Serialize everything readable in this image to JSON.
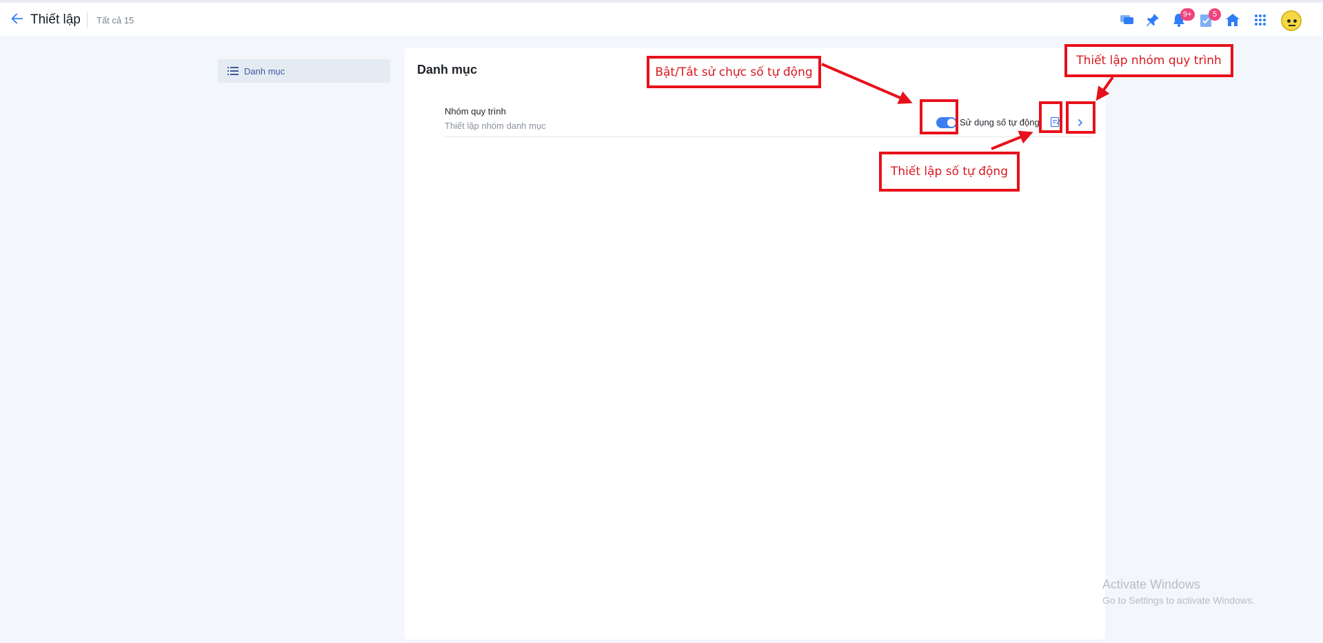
{
  "header": {
    "title": "Thiết lập",
    "count_label": "Tất cả 15",
    "notification_badge": "9+",
    "task_badge": "5"
  },
  "sidebar": {
    "items": [
      {
        "label": "Danh mục",
        "icon": "list-icon"
      }
    ]
  },
  "main": {
    "title": "Danh mục",
    "rows": [
      {
        "title": "Nhóm quy trình",
        "subtitle": "Thiết lập nhóm danh mục",
        "toggle_on": true,
        "toggle_label": "Sử dụng số tự động"
      }
    ]
  },
  "annotations": {
    "toggle_note": "Bật/Tắt sử chực số tự động",
    "auto_number_note": "Thiết lập số tự động",
    "group_note": "Thiết lập nhóm quy trình"
  },
  "watermark": {
    "line1": "Activate Windows",
    "line2": "Go to Settings to activate Windows."
  },
  "colors": {
    "accent": "#3d7ff0",
    "badge": "#f0447b",
    "annotation": "#e8101a"
  }
}
